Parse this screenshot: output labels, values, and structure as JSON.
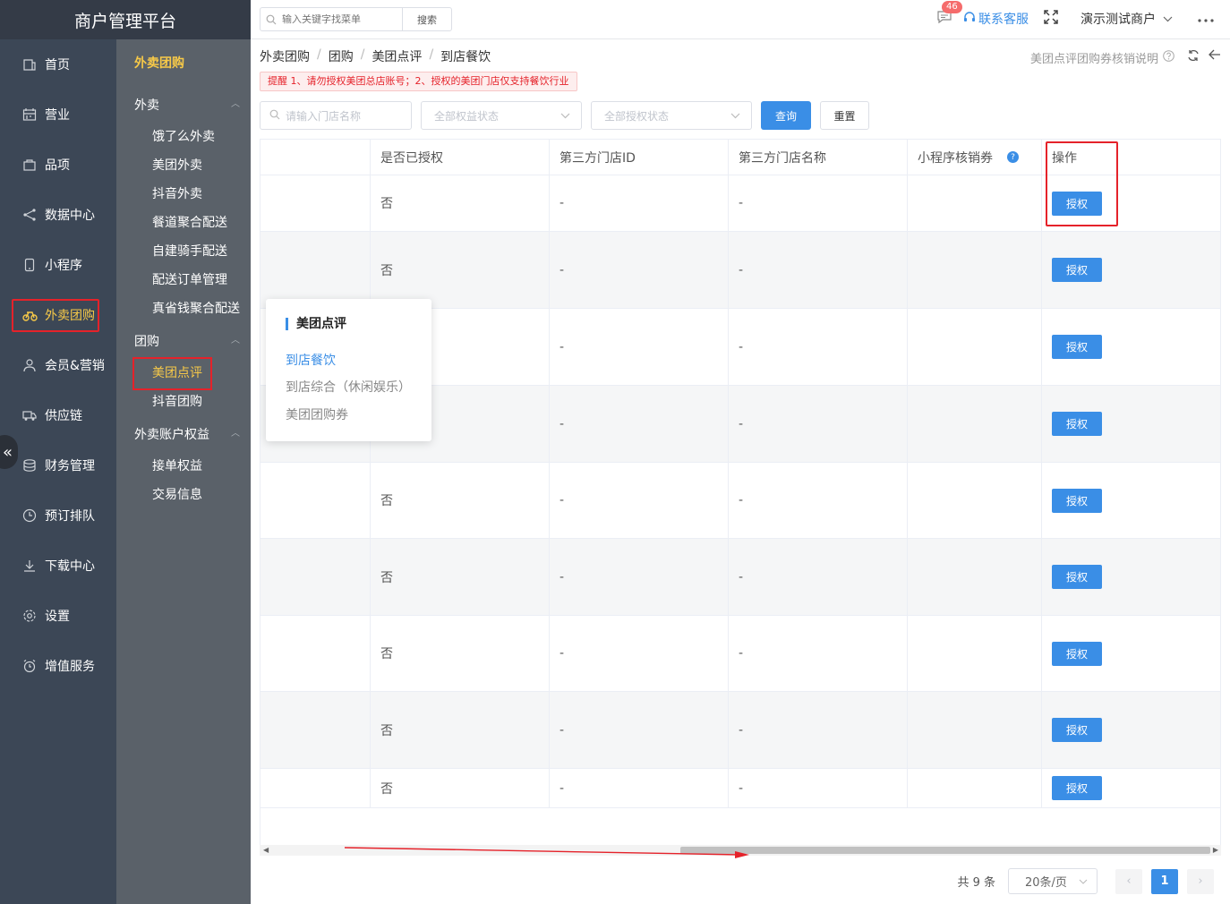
{
  "brand": "商户管理平台",
  "nav": [
    {
      "label": "首页",
      "icon": "home-icon"
    },
    {
      "label": "营业",
      "icon": "calendar-icon"
    },
    {
      "label": "品项",
      "icon": "bag-icon"
    },
    {
      "label": "数据中心",
      "icon": "share-icon"
    },
    {
      "label": "小程序",
      "icon": "phone-icon"
    },
    {
      "label": "外卖团购",
      "icon": "bike-icon",
      "active": true
    },
    {
      "label": "会员&营销",
      "icon": "user-icon"
    },
    {
      "label": "供应链",
      "icon": "truck-icon"
    },
    {
      "label": "财务管理",
      "icon": "database-icon"
    },
    {
      "label": "预订排队",
      "icon": "clock-icon"
    },
    {
      "label": "下载中心",
      "icon": "download-icon"
    },
    {
      "label": "设置",
      "icon": "gear-icon"
    },
    {
      "label": "增值服务",
      "icon": "alarm-icon"
    }
  ],
  "sub": {
    "title": "外卖团购",
    "groups": [
      {
        "label": "外卖",
        "items": [
          "饿了么外卖",
          "美团外卖",
          "抖音外卖",
          "餐道聚合配送",
          "自建骑手配送",
          "配送订单管理",
          "真省钱聚合配送"
        ]
      },
      {
        "label": "团购",
        "items": [
          "美团点评",
          "抖音团购"
        ]
      },
      {
        "label": "外卖账户权益",
        "items": [
          "接单权益",
          "交易信息"
        ]
      }
    ]
  },
  "topbar": {
    "search_placeholder": "输入关键字找菜单",
    "search_button": "搜索",
    "badge": "46",
    "service": "联系客服",
    "merchant": "演示测试商户"
  },
  "breadcrumb": [
    "外卖团购",
    "团购",
    "美团点评",
    "到店餐饮"
  ],
  "help": "美团点评团购券核销说明",
  "notice": "提醒 1、请勿授权美团总店账号；2、授权的美团门店仅支持餐饮行业",
  "filters": {
    "store_placeholder": "请输入门店名称",
    "equity_status": "全部权益状态",
    "auth_status": "全部授权状态",
    "query": "查询",
    "reset": "重置"
  },
  "table": {
    "headers": [
      "",
      "是否已授权",
      "第三方门店ID",
      "第三方门店名称",
      "小程序核销券",
      "操作"
    ],
    "rows": [
      {
        "authorized": "否",
        "store_id": "-",
        "store_name": "-",
        "action": "授权"
      },
      {
        "authorized": "否",
        "store_id": "-",
        "store_name": "-",
        "action": "授权"
      },
      {
        "authorized": "",
        "store_id": "-",
        "store_name": "-",
        "action": "授权"
      },
      {
        "authorized": "",
        "store_id": "-",
        "store_name": "-",
        "action": "授权"
      },
      {
        "authorized": "否",
        "store_id": "-",
        "store_name": "-",
        "action": "授权"
      },
      {
        "authorized": "否",
        "store_id": "-",
        "store_name": "-",
        "action": "授权"
      },
      {
        "authorized": "否",
        "store_id": "-",
        "store_name": "-",
        "action": "授权"
      },
      {
        "authorized": "否",
        "store_id": "-",
        "store_name": "-",
        "action": "授权"
      },
      {
        "authorized": "否",
        "store_id": "-",
        "store_name": "-",
        "action": "授权"
      }
    ]
  },
  "pager": {
    "total": "共 9 条",
    "size": "20条/页",
    "current": "1"
  },
  "popup": {
    "title": "美团点评",
    "items": [
      "到店餐饮",
      "到店综合（休闲娱乐）",
      "美团团购券"
    ]
  }
}
